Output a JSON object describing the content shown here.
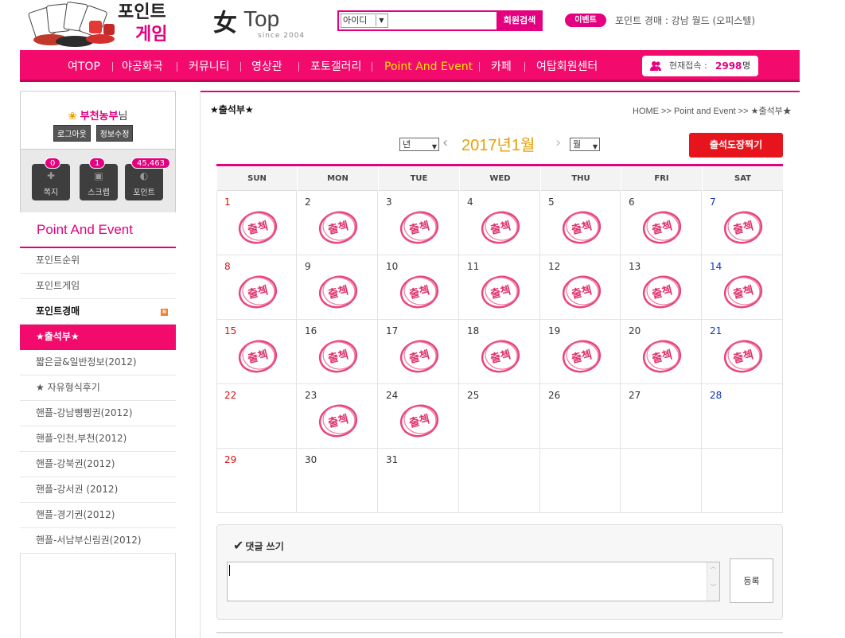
{
  "header": {
    "logo_game_line1": "포인트",
    "logo_game_line2": "게임",
    "logo_main_glyph": "女",
    "logo_main_text": "Top",
    "logo_since": "since 2004",
    "search_select": "아이디",
    "search_button": "회원검색",
    "event_badge": "이벤트",
    "event_text": "포인트 경매 : 강남 월드 (오피스텔)"
  },
  "nav": {
    "items": [
      "여TOP",
      "야공화국",
      "커뮤니티",
      "영상관",
      "포토갤러리",
      "Point And Event",
      "카페",
      "여탑회원센터"
    ],
    "active_index": 5,
    "online_label": "현재접속 :",
    "online_count": "2998",
    "online_unit": "명"
  },
  "user": {
    "name": "부천농부",
    "suffix": "님",
    "logout": "로그아웃",
    "edit": "정보수정",
    "quick": [
      {
        "label": "쪽지",
        "count": "0"
      },
      {
        "label": "스크랩",
        "count": "1"
      },
      {
        "label": "포인트",
        "count": "45,463"
      }
    ]
  },
  "sidebar": {
    "title": "Point And Event",
    "items": [
      "포인트순위",
      "포인트게임",
      "포인트경매",
      "★출석부★",
      "짧은글&일반정보(2012)",
      "★ 자유형식후기",
      "핸플-강남삥삥권(2012)",
      "핸플-인천,부천(2012)",
      "핸플-강북권(2012)",
      "핸플-강서권 (2012)",
      "핸플-경기권(2012)",
      "핸플-서남부신림권(2012)"
    ],
    "new_badge": "N"
  },
  "page": {
    "title": "★출석부★",
    "breadcrumb": "HOME >> Point and Event >> ★출석부★",
    "year_select": "년",
    "month_select": "월",
    "prev": "‹",
    "next": "›",
    "year_month": "2017년1월",
    "stamp_button": "출석도장찍기"
  },
  "calendar": {
    "weekdays": [
      "SUN",
      "MON",
      "TUE",
      "WED",
      "THU",
      "FRI",
      "SAT"
    ],
    "stamp_text": "출첵",
    "weeks": [
      [
        {
          "d": "1",
          "s": true
        },
        {
          "d": "2",
          "s": true
        },
        {
          "d": "3",
          "s": true
        },
        {
          "d": "4",
          "s": true
        },
        {
          "d": "5",
          "s": true
        },
        {
          "d": "6",
          "s": true
        },
        {
          "d": "7",
          "s": true
        }
      ],
      [
        {
          "d": "8",
          "s": true
        },
        {
          "d": "9",
          "s": true
        },
        {
          "d": "10",
          "s": true
        },
        {
          "d": "11",
          "s": true
        },
        {
          "d": "12",
          "s": true
        },
        {
          "d": "13",
          "s": true
        },
        {
          "d": "14",
          "s": true
        }
      ],
      [
        {
          "d": "15",
          "s": true
        },
        {
          "d": "16",
          "s": true
        },
        {
          "d": "17",
          "s": true
        },
        {
          "d": "18",
          "s": true
        },
        {
          "d": "19",
          "s": true
        },
        {
          "d": "20",
          "s": true
        },
        {
          "d": "21",
          "s": true
        }
      ],
      [
        {
          "d": "22",
          "s": false
        },
        {
          "d": "23",
          "s": true
        },
        {
          "d": "24",
          "s": true
        },
        {
          "d": "25",
          "s": false
        },
        {
          "d": "26",
          "s": false
        },
        {
          "d": "27",
          "s": false
        },
        {
          "d": "28",
          "s": false
        }
      ],
      [
        {
          "d": "29",
          "s": false
        },
        {
          "d": "30",
          "s": false
        },
        {
          "d": "31",
          "s": false
        },
        {
          "d": "",
          "s": false
        },
        {
          "d": "",
          "s": false
        },
        {
          "d": "",
          "s": false
        },
        {
          "d": "",
          "s": false
        }
      ]
    ]
  },
  "comment": {
    "check": "✔",
    "label": "댓글 쓰기",
    "value": "",
    "submit": "등록"
  },
  "colors": {
    "accent": "#e4007f",
    "nav_bg": "#f20a6c",
    "active_nav": "#ffe600",
    "stamp_button": "#e8141d",
    "month_text": "#e8a000"
  }
}
